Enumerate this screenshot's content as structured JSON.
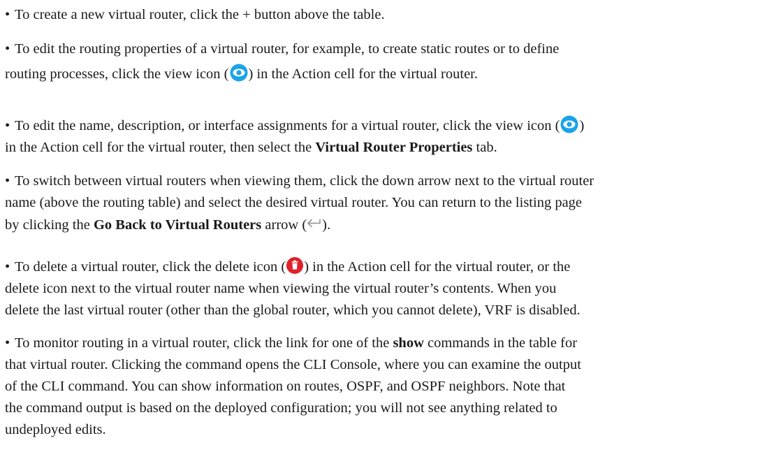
{
  "bullet_char": "•",
  "items": [
    {
      "id": "create",
      "l1": "To create a new virtual router, click the + button above the table."
    },
    {
      "id": "edit-routing",
      "l1": "To edit the routing properties of a virtual router, for example, to create static routes or to define",
      "l2_a": "routing processes, click the view icon (",
      "l2_b": ") in the Action cell for the virtual router."
    },
    {
      "id": "edit-name",
      "l1_a": "To edit the name, description, or interface assignments for a virtual router, click the view icon (",
      "l1_b": ")",
      "l2_a": "in the Action cell for the virtual router, then select the ",
      "l2_bold": "Virtual Router Properties",
      "l2_b": " tab."
    },
    {
      "id": "switch",
      "l1": "To switch between virtual routers when viewing them, click the down arrow next to the virtual router",
      "l2": "name (above the routing table) and select the desired virtual router. You can return to the listing page",
      "l3_a": "by clicking the ",
      "l3_bold": "Go Back to Virtual Routers",
      "l3_b": " arrow (",
      "l3_c": ")."
    },
    {
      "id": "delete",
      "l1_a": "To delete a virtual router, click the delete icon (",
      "l1_b": ") in the Action cell for the virtual router, or the",
      "l2": "delete icon next to the virtual router name when viewing the virtual router’s contents. When you",
      "l3": "delete the last virtual router (other than the global router, which you cannot delete), VRF is disabled."
    },
    {
      "id": "monitor",
      "l1_a": "To monitor routing in a virtual router, click the link for one of the ",
      "l1_bold": "show",
      "l1_b": " commands in the table for",
      "l2": "that virtual router. Clicking the command opens the CLI Console, where you can examine the output",
      "l3": "of the CLI command. You can show information on routes, OSPF, and OSPF neighbors. Note that",
      "l4": "the command output is based on the deployed configuration; you will not see anything related to",
      "l5": "undeployed edits."
    }
  ],
  "icons": {
    "view": "eye-view-icon",
    "delete": "trash-delete-icon",
    "back": "back-arrow-icon"
  },
  "colors": {
    "text": "#1a1a1a",
    "view_icon": "#1aa3e8",
    "delete_icon": "#e0202a",
    "back_icon": "#9a9a9a"
  }
}
